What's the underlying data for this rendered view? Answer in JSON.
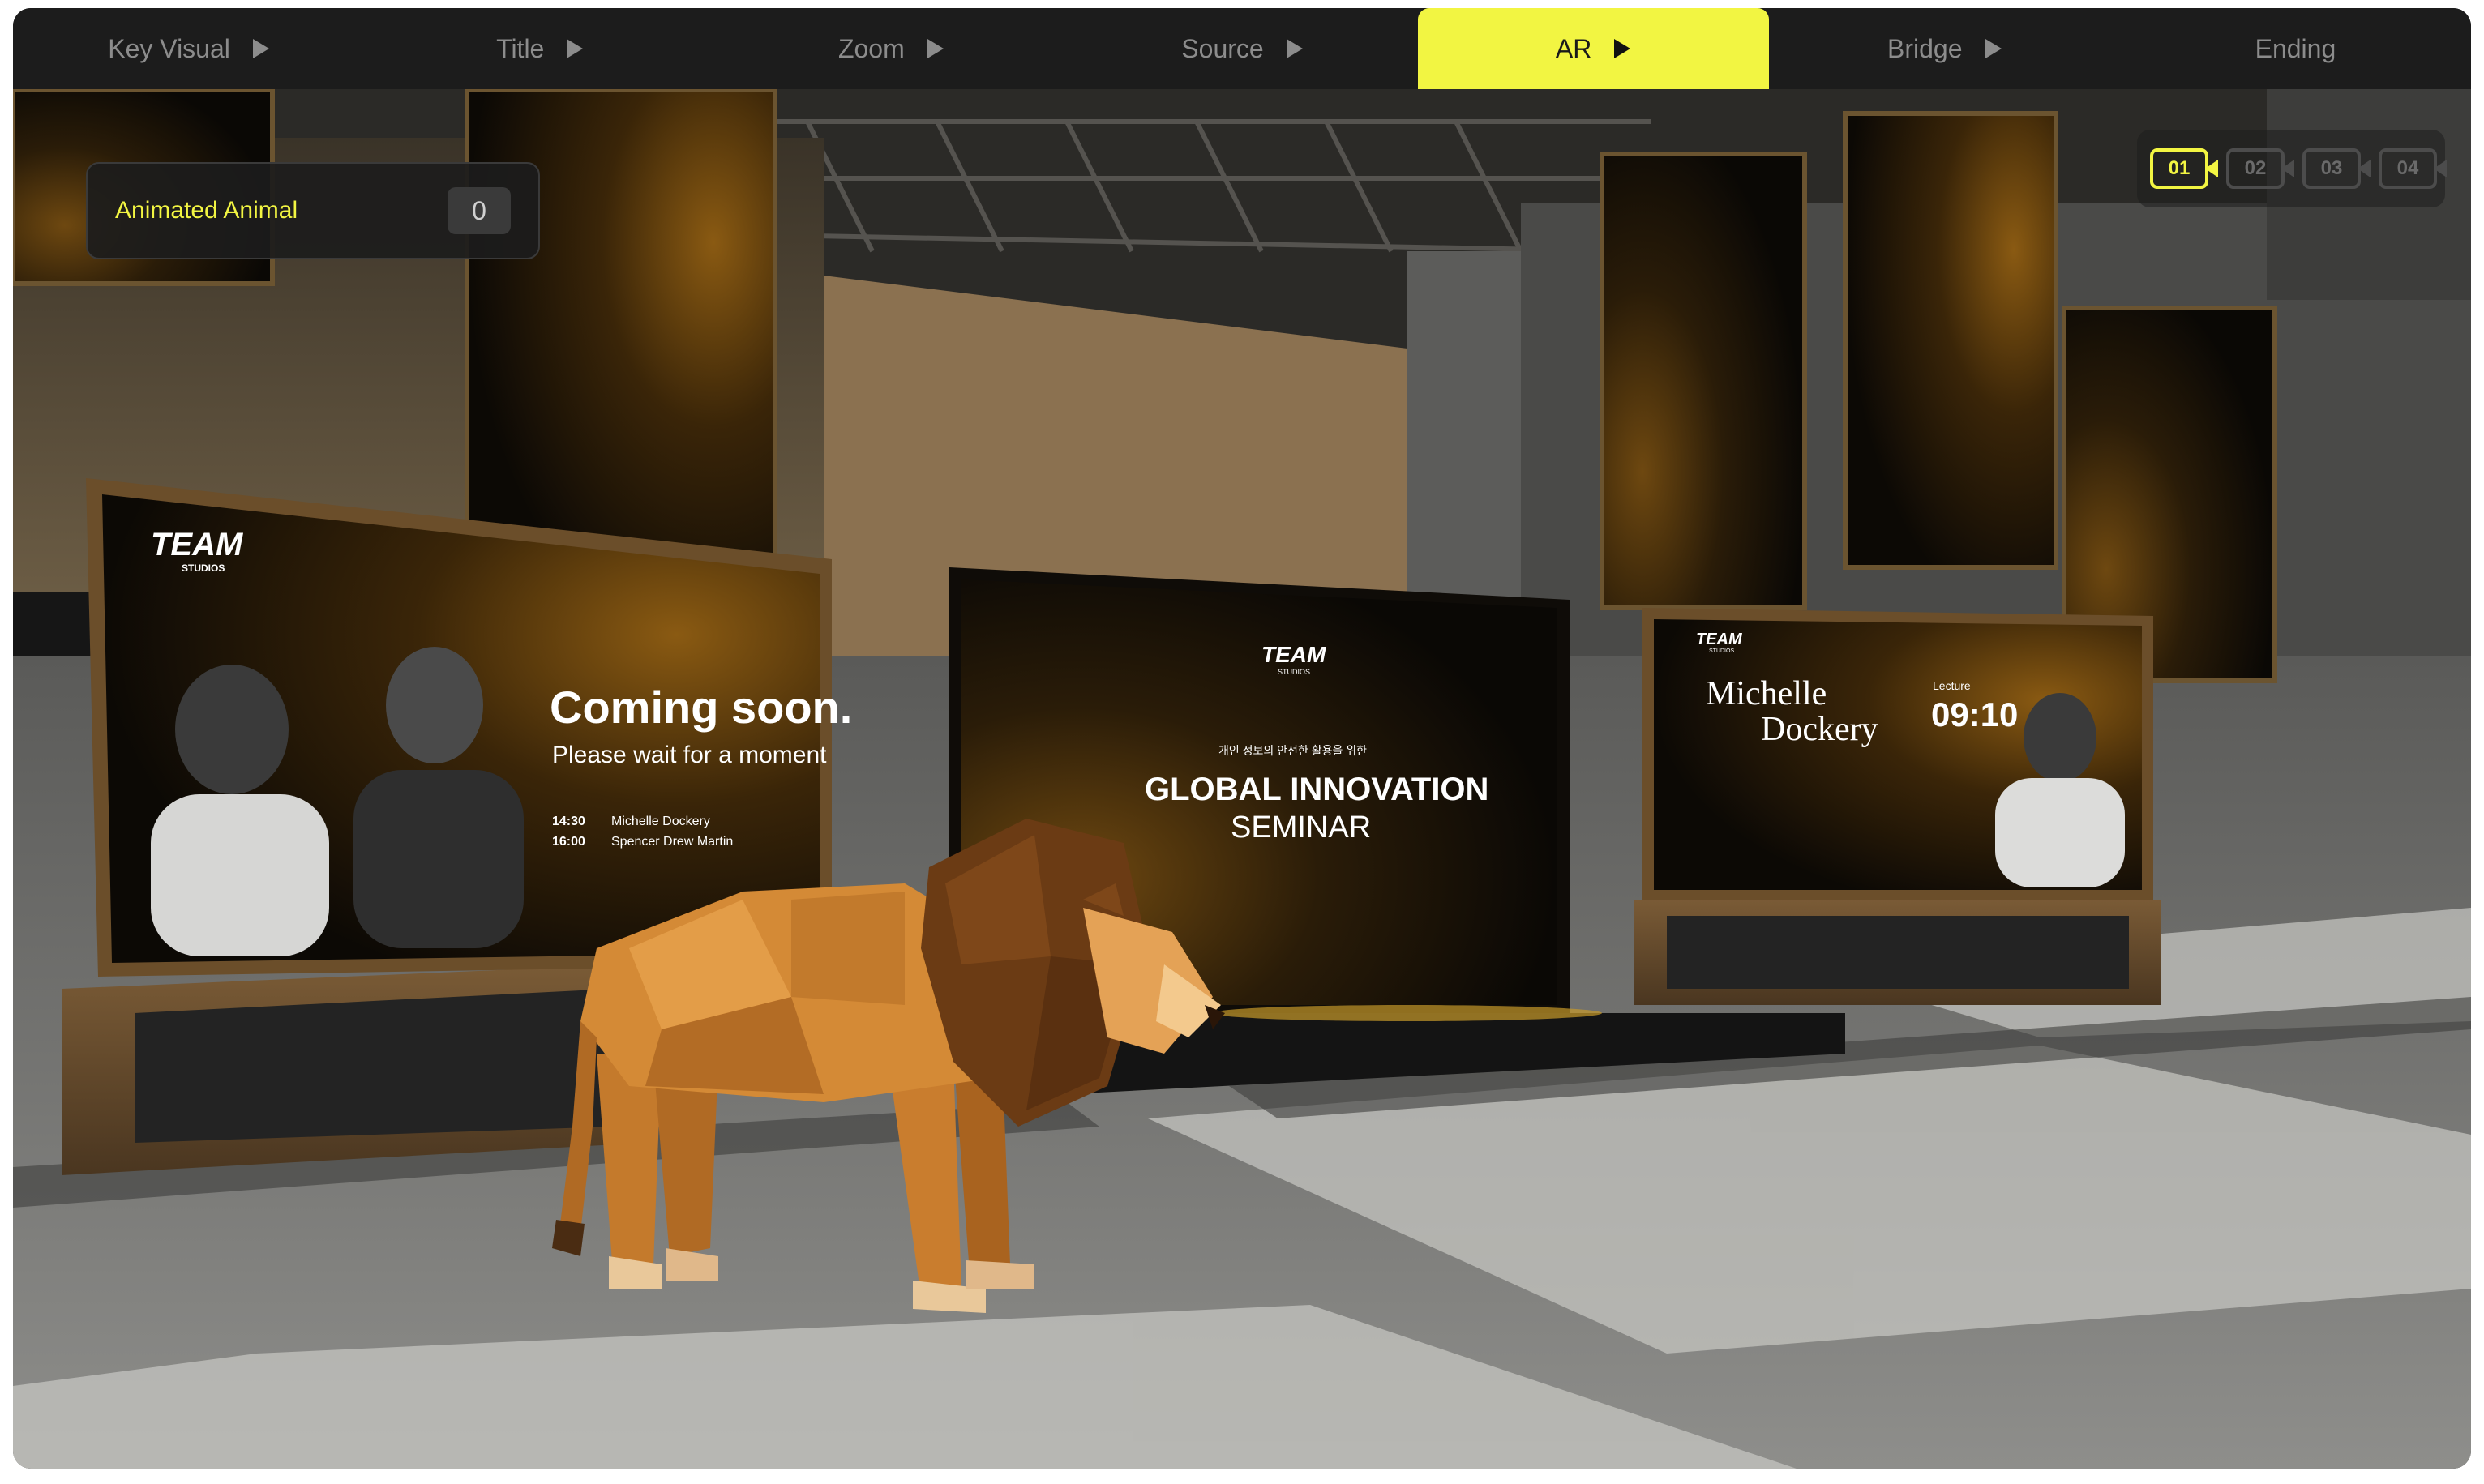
{
  "tabs": [
    {
      "label": "Key Visual"
    },
    {
      "label": "Title"
    },
    {
      "label": "Zoom"
    },
    {
      "label": "Source"
    },
    {
      "label": "AR"
    },
    {
      "label": "Bridge"
    },
    {
      "label": "Ending"
    }
  ],
  "active_tab": "AR",
  "ar_panel": {
    "label": "Animated Animal",
    "count": "0"
  },
  "cameras": [
    "01",
    "02",
    "03",
    "04"
  ],
  "active_camera": "01",
  "screens": {
    "left": {
      "logo": "TEAM",
      "logo_sub": "STUDIOS",
      "heading": "Coming soon.",
      "subheading": "Please wait for a moment",
      "schedule": [
        {
          "time": "14:30",
          "name": "Michelle Dockery"
        },
        {
          "time": "16:00",
          "name": "Spencer Drew Martin"
        }
      ]
    },
    "center": {
      "logo": "TEAM",
      "logo_sub": "STUDIOS",
      "kicker": "개인 정보의 안전한 활용을 위한",
      "title": "GLOBAL INNOVATION",
      "subtitle": "SEMINAR"
    },
    "right": {
      "logo": "TEAM",
      "logo_sub": "STUDIOS",
      "name_line1": "Michelle",
      "name_line2": "Dockery",
      "lecture_label": "Lecture",
      "lecture_time": "09:10"
    }
  },
  "colors": {
    "accent": "#f2f542",
    "background": "#161616",
    "tabbar": "#1c1c1c"
  }
}
